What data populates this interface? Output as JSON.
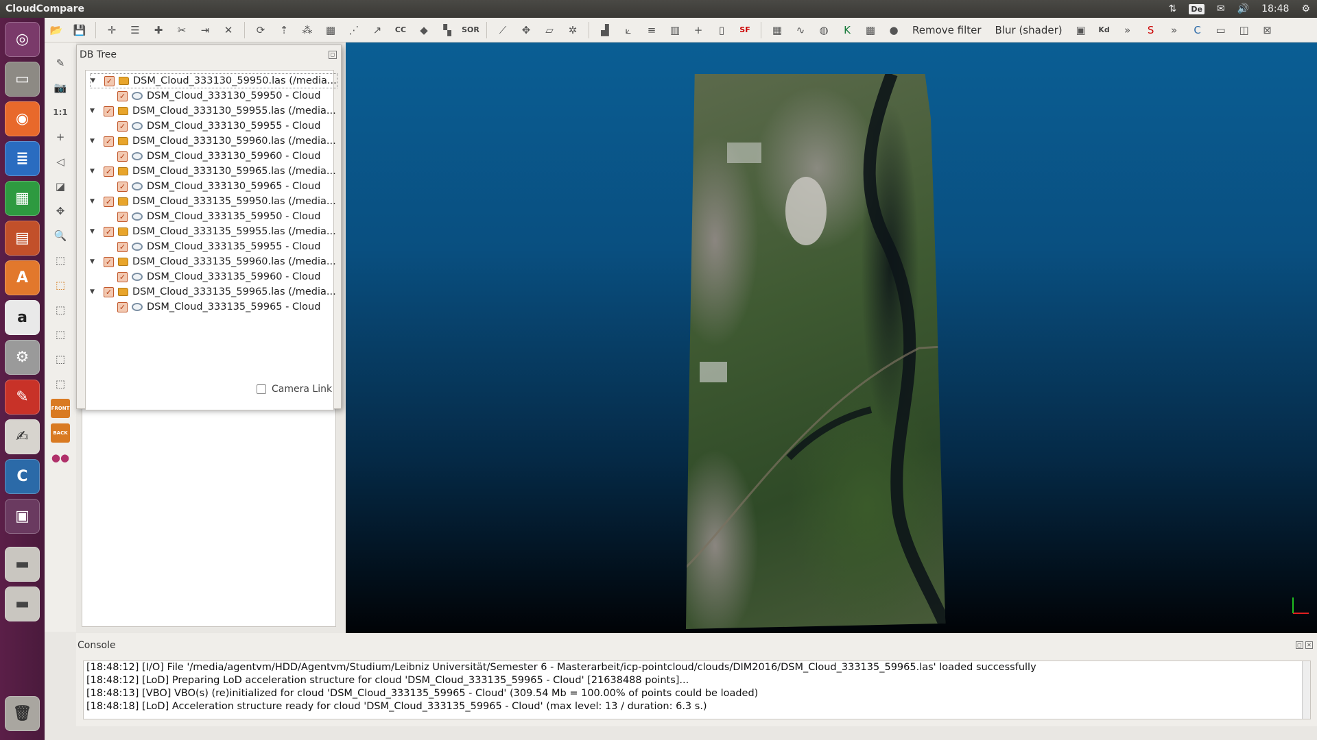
{
  "window": {
    "app_title": "CloudCompare",
    "clock": "18:48",
    "keyboard_layout": "De"
  },
  "toolbar": {
    "sor_label": "SOR",
    "cc_label": "CC",
    "sf_label": "SF",
    "remove_filter_label": "Remove filter",
    "blur_label": "Blur (shader)",
    "kd_label": "Kd",
    "more1": "»",
    "more2": "»",
    "more3": "»"
  },
  "left_toolbar": {
    "ratio_label": "1:1",
    "front_label": "FRONT",
    "back_label": "BACK"
  },
  "db_tree": {
    "title": "DB Tree",
    "items": [
      {
        "label": "DSM_Cloud_333130_59950.las (/media...",
        "child": "DSM_Cloud_333130_59950 - Cloud"
      },
      {
        "label": "DSM_Cloud_333130_59955.las (/media...",
        "child": "DSM_Cloud_333130_59955 - Cloud"
      },
      {
        "label": "DSM_Cloud_333130_59960.las (/media...",
        "child": "DSM_Cloud_333130_59960 - Cloud"
      },
      {
        "label": "DSM_Cloud_333130_59965.las (/media...",
        "child": "DSM_Cloud_333130_59965 - Cloud"
      },
      {
        "label": "DSM_Cloud_333135_59950.las (/media...",
        "child": "DSM_Cloud_333135_59950 - Cloud"
      },
      {
        "label": "DSM_Cloud_333135_59955.las (/media...",
        "child": "DSM_Cloud_333135_59955 - Cloud"
      },
      {
        "label": "DSM_Cloud_333135_59960.las (/media...",
        "child": "DSM_Cloud_333135_59960 - Cloud"
      },
      {
        "label": "DSM_Cloud_333135_59965.las (/media...",
        "child": "DSM_Cloud_333135_59965 - Cloud"
      }
    ],
    "camera_link_label": "Camera Link"
  },
  "console": {
    "title": "Console",
    "lines": [
      "[18:48:12] [I/O] File '/media/agentvm/HDD/Agentvm/Studium/Leibniz Universität/Semester 6 - Masterarbeit/icp-pointcloud/clouds/DIM2016/DSM_Cloud_333135_59965.las' loaded successfully",
      "[18:48:12] [LoD] Preparing LoD acceleration structure for cloud 'DSM_Cloud_333135_59965 - Cloud' [21638488 points]...",
      "[18:48:13] [VBO] VBO(s) (re)initialized for cloud 'DSM_Cloud_333135_59965 - Cloud' (309.54 Mb = 100.00% of points could be loaded)",
      "[18:48:18] [LoD] Acceleration structure ready for cloud 'DSM_Cloud_333135_59965 - Cloud' (max level: 13 / duration: 6.3 s.)"
    ]
  },
  "colors": {
    "launcher": "#5b1f48",
    "viewport_top": "#0a5e94",
    "viewport_bottom": "#010306"
  }
}
